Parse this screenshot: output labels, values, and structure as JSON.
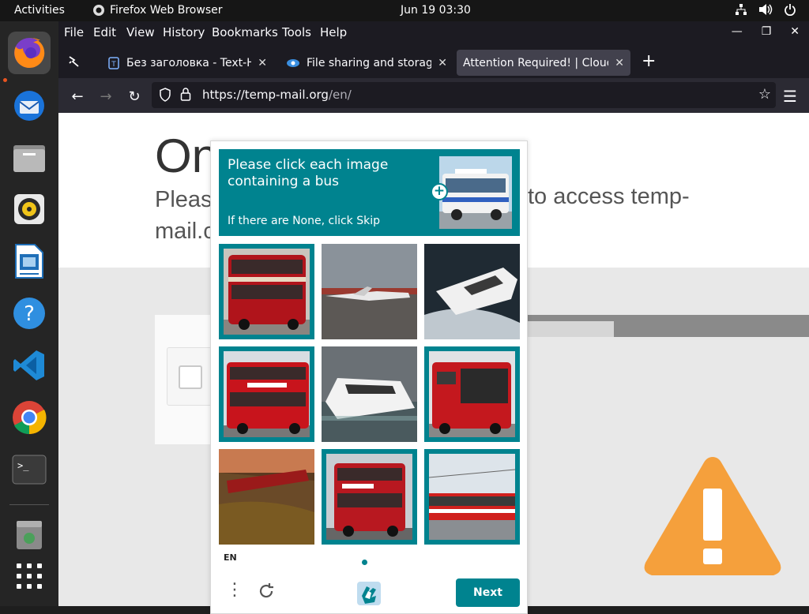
{
  "topbar": {
    "activities": "Activities",
    "app_name": "Firefox Web Browser",
    "clock": "Jun 19  03:30",
    "tray_icons": [
      "network-icon",
      "volume-icon",
      "power-icon"
    ]
  },
  "dock": {
    "items": [
      "firefox",
      "thunderbird",
      "files",
      "rhythmbox",
      "libreoffice-writer",
      "help",
      "vscode",
      "chrome",
      "terminal",
      "trash",
      "show-apps"
    ]
  },
  "menubar": {
    "items": [
      "File",
      "Edit",
      "View",
      "History",
      "Bookmarks",
      "Tools",
      "Help"
    ]
  },
  "tabs": [
    {
      "title": "Без заголовка - Text-Hos",
      "active": false
    },
    {
      "title": "File sharing and storage r",
      "active": false
    },
    {
      "title": "Attention Required! | Cloudf",
      "active": true
    }
  ],
  "navbar": {
    "url_host": "https://temp-mail.org",
    "url_path": "/en/"
  },
  "page": {
    "heading_partial": "On",
    "sub_line1_partial": "Pleas",
    "sub_line1_end": "to access temp-",
    "sub_line2_partial": "mail.c"
  },
  "captcha": {
    "prompt_line1": "Please click each image",
    "prompt_line2": "containing a bus",
    "skip_text": "If there are None, click Skip",
    "lang": "EN",
    "next_label": "Next",
    "accent": "#00838f",
    "tiles": [
      {
        "subject": "red double-decker bus",
        "selected": true
      },
      {
        "subject": "airplane on runway",
        "selected": false
      },
      {
        "subject": "speedboat",
        "selected": false
      },
      {
        "subject": "red double-decker bus",
        "selected": true
      },
      {
        "subject": "white yacht",
        "selected": false
      },
      {
        "subject": "red city bus",
        "selected": true
      },
      {
        "subject": "red train in autumn",
        "selected": false
      },
      {
        "subject": "red double-decker bus",
        "selected": true
      },
      {
        "subject": "red tram",
        "selected": true
      }
    ]
  }
}
